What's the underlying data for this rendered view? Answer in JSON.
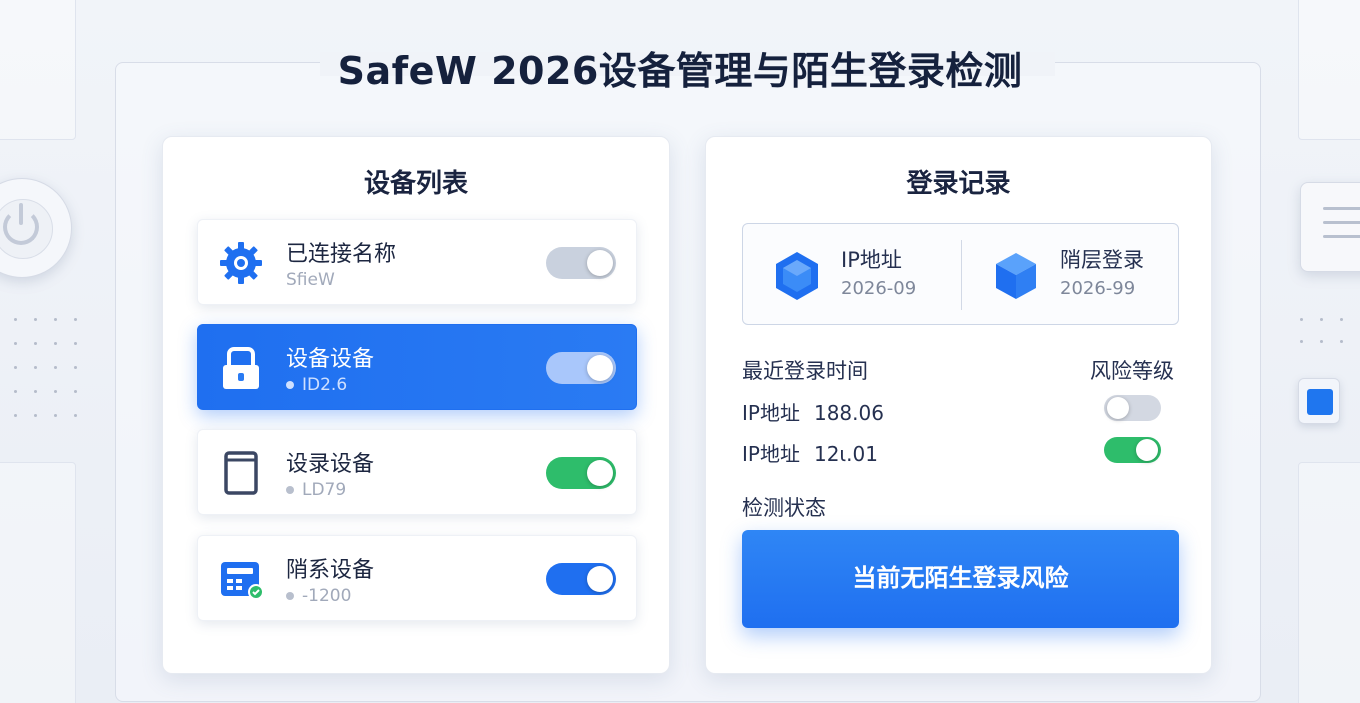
{
  "header": {
    "title": "SafeW 2026设备管理与陌生登录检测"
  },
  "device_panel": {
    "title": "设备列表",
    "devices": [
      {
        "name": "已连接名称",
        "sub": "SfieW",
        "icon": "gear-icon",
        "toggle": "on",
        "active": false
      },
      {
        "name": "设备设备",
        "sub": "ID2.6",
        "icon": "lock-icon",
        "toggle": "on",
        "active": true
      },
      {
        "name": "设录设备",
        "sub": "LD79",
        "icon": "tablet-icon",
        "toggle": "on",
        "active": false
      },
      {
        "name": "陗系设备",
        "sub": "-1200",
        "icon": "card-reader-icon",
        "toggle": "on",
        "active": false
      }
    ]
  },
  "login_panel": {
    "title": "登录记录",
    "summary": [
      {
        "label": "IP地址",
        "value": "2026-09",
        "icon": "hexagon-icon"
      },
      {
        "label": "陗层登录",
        "value": "2026-99",
        "icon": "cube-icon"
      }
    ],
    "recent_header": "最近登录时间",
    "risk_header": "风险等级",
    "records": [
      {
        "label": "IP地址",
        "ip": "188.06",
        "toggle": "off"
      },
      {
        "label": "IP地址",
        "ip": "12ι.01",
        "toggle": "on"
      }
    ],
    "status_label": "检测状态",
    "status_button": "当前无陌生登录风险"
  },
  "colors": {
    "accent": "#1f6ff0",
    "toggle_green": "#2ebd6b",
    "background": "#eef1f6"
  }
}
